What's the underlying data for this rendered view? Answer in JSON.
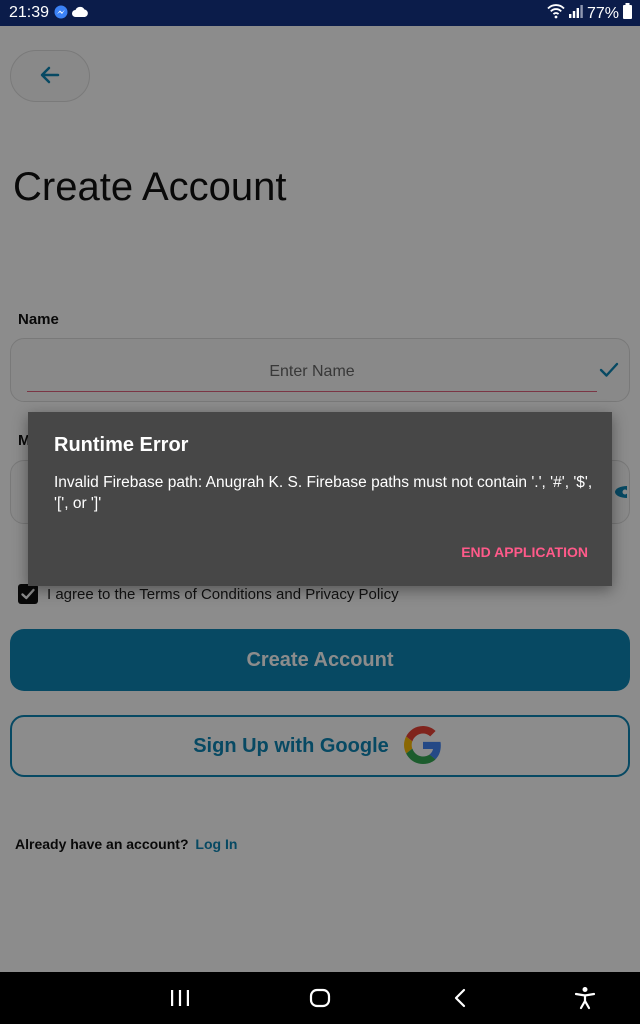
{
  "status_bar": {
    "time": "21:39",
    "battery_percent": "77%",
    "icons": [
      "messenger-icon",
      "cloud-icon",
      "wifi-icon",
      "signal-icon",
      "battery-icon"
    ]
  },
  "header": {
    "title": "Create Account"
  },
  "form": {
    "name_label": "Name",
    "name_placeholder": "Enter Name",
    "mobile_label": "M",
    "terms_checked": true,
    "terms_text": "I agree to the Terms of Conditions and Privacy Policy"
  },
  "buttons": {
    "create_account": "Create Account",
    "google_signup": "Sign Up with Google"
  },
  "footer": {
    "login_prompt": "Already have an account?",
    "login_link": "Log In"
  },
  "dialog": {
    "title": "Runtime Error",
    "message": "Invalid Firebase path: Anugrah K. S. Firebase paths must not contain '.', '#', '$', '[', or ']'",
    "action": "END APPLICATION"
  },
  "colors": {
    "accent": "#0d86b4",
    "status_bar": "#0b1c4a",
    "dialog_bg": "#474747",
    "dialog_action": "#ff5a8a",
    "input_underline": "#e0637f"
  }
}
